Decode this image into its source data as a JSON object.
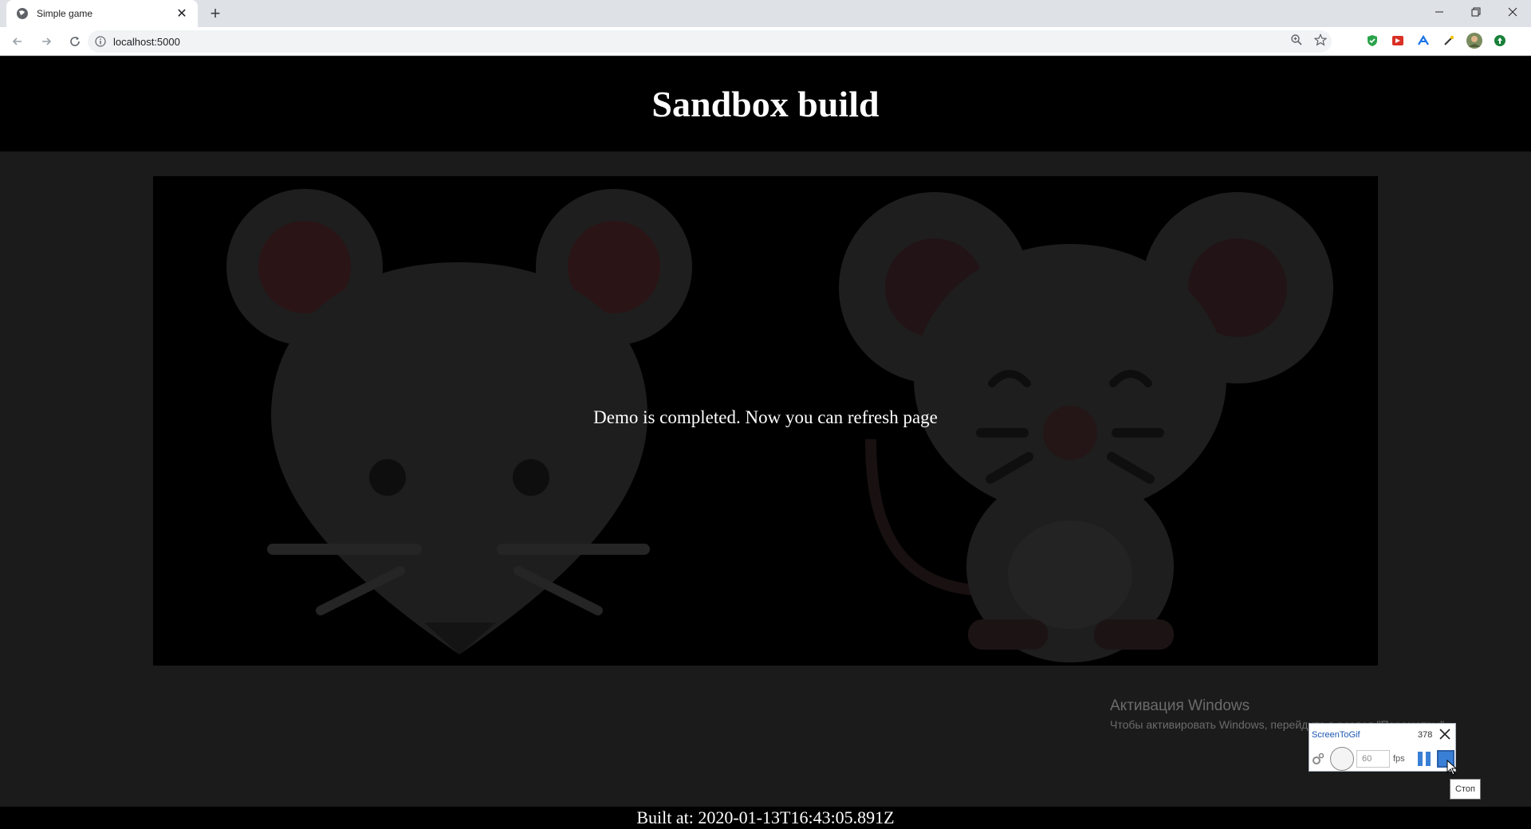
{
  "browser": {
    "tab_title": "Simple game",
    "url": "localhost:5000",
    "new_tab_symbol": "+",
    "close_symbol": "✕",
    "icons": [
      "globe-icon",
      "back-icon",
      "forward-icon",
      "reload-icon",
      "info-icon",
      "zoom-icon",
      "star-icon",
      "shield-extension-icon",
      "red-extension-icon",
      "blue-extension-icon",
      "eyedropper-extension-icon",
      "profile-avatar",
      "green-extension-icon"
    ]
  },
  "page": {
    "title": "Sandbox build",
    "message": "Demo is completed. Now you can refresh page",
    "built_at": "Built at: 2020-01-13T16:43:05.891Z"
  },
  "windows_activation": {
    "title": "Активация Windows",
    "subtitle": "Чтобы активировать Windows, перейдите в раздел \"Параметры\"."
  },
  "screentogif": {
    "title": "ScreenToGif",
    "frame_count": "378",
    "fps_value": "60",
    "fps_label": "fps",
    "stop_tooltip": "Стоп"
  },
  "colors": {
    "page_bg": "#1b1b1b",
    "header_bg": "#000000",
    "canvas_bg": "#000000",
    "accent_blue": "#3a7fd6"
  }
}
